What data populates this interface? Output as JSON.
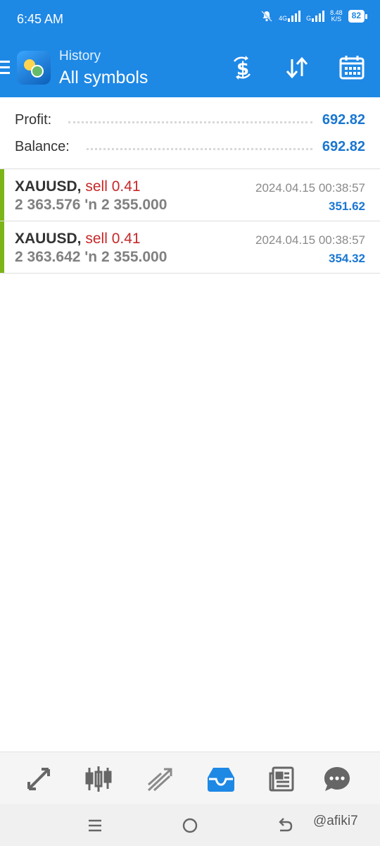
{
  "status_bar": {
    "time": "6:45 AM",
    "net1": "4G",
    "net2": "G",
    "speed_value": "8.48",
    "speed_unit": "K/S",
    "battery": "82"
  },
  "header": {
    "subtitle": "History",
    "title": "All symbols",
    "icons": [
      "dollar-exchange-icon",
      "sort-icon",
      "calendar-icon"
    ]
  },
  "summary": {
    "profit_label": "Profit:",
    "profit_value": "692.82",
    "balance_label": "Balance:",
    "balance_value": "692.82"
  },
  "deals": [
    {
      "symbol": "XAUUSD,",
      "side": "sell 0.41",
      "open_price": "2 363.576",
      "arrow": "'n",
      "close_price": "2 355.000",
      "time": "2024.04.15 00:38:57",
      "profit": "351.62"
    },
    {
      "symbol": "XAUUSD,",
      "side": "sell 0.41",
      "open_price": "2 363.642",
      "arrow": "'n",
      "close_price": "2 355.000",
      "time": "2024.04.15 00:38:57",
      "profit": "354.32"
    }
  ],
  "bottom_nav": {
    "items": [
      "quotes-icon",
      "chart-icon",
      "trade-icon",
      "history-icon",
      "news-icon",
      "chat-icon"
    ],
    "active": "history-icon"
  },
  "colors": {
    "accent": "#1e88e5",
    "profit": "#1976d2",
    "sell": "#c62828",
    "deal_bar": "#7cb518"
  },
  "watermark": "@afiki7"
}
